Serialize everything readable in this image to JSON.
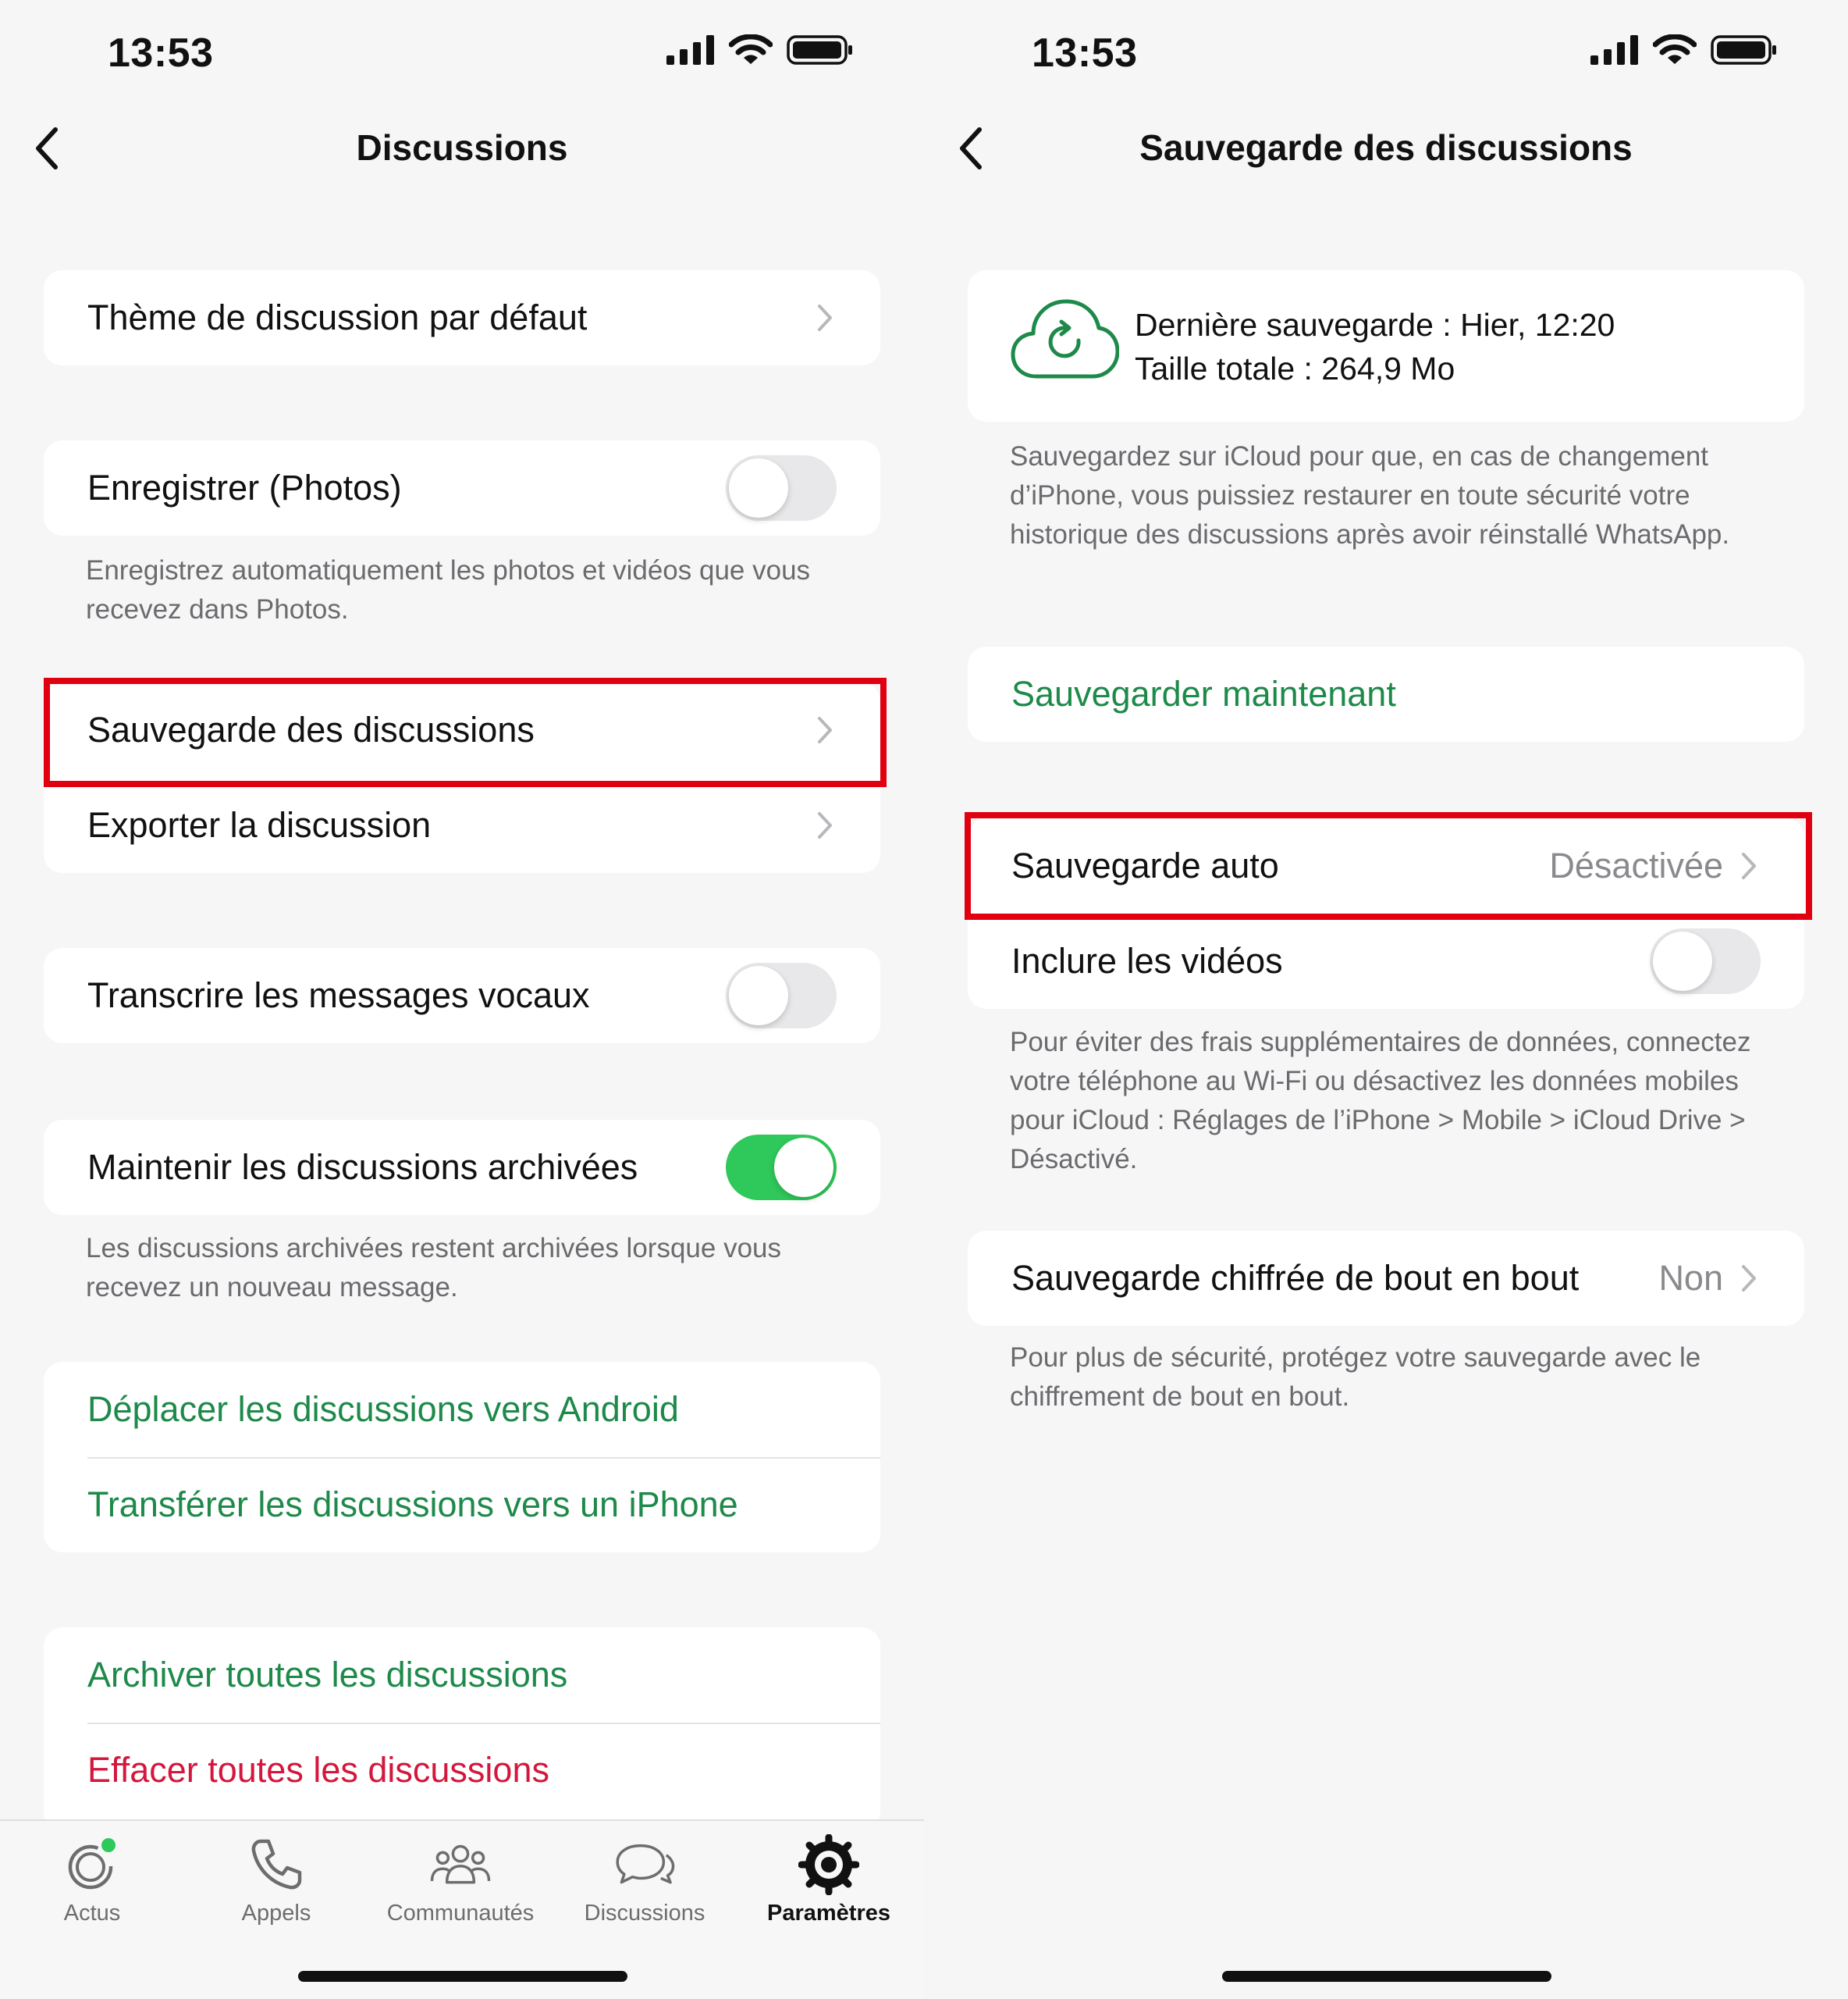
{
  "left": {
    "status_time": "13:53",
    "nav_title": "Discussions",
    "rows": {
      "theme": "Thème de discussion par défaut",
      "save_photos": "Enregistrer (Photos)",
      "save_photos_on": false,
      "save_photos_footer": "Enregistrez automatiquement les photos et vidéos que vous recevez dans Photos.",
      "chat_backup": "Sauvegarde des discussions",
      "export_chat": "Exporter la discussion",
      "transcribe": "Transcrire les messages vocaux",
      "transcribe_on": false,
      "keep_archived": "Maintenir les discussions archivées",
      "keep_archived_on": true,
      "keep_archived_footer": "Les discussions archivées restent archivées lorsque vous recevez un nouveau message.",
      "move_android": "Déplacer les discussions vers Android",
      "transfer_iphone": "Transférer les discussions vers un iPhone",
      "archive_all": "Archiver toutes les discussions",
      "clear_all": "Effacer toutes les discussions"
    },
    "tabs": [
      {
        "label": "Actus",
        "icon": "updates-icon"
      },
      {
        "label": "Appels",
        "icon": "phone-icon"
      },
      {
        "label": "Communautés",
        "icon": "communities-icon"
      },
      {
        "label": "Discussions",
        "icon": "chats-icon"
      },
      {
        "label": "Paramètres",
        "icon": "settings-icon",
        "active": true
      }
    ]
  },
  "right": {
    "status_time": "13:53",
    "nav_title": "Sauvegarde des discussions",
    "last_backup": "Dernière sauvegarde : Hier, 12:20",
    "total_size": "Taille totale : 264,9 Mo",
    "info_footer": "Sauvegardez sur iCloud pour que, en cas de changement d’iPhone, vous puissiez restaurer en toute sécurité votre historique des discussions après avoir réinstallé WhatsApp.",
    "backup_now": "Sauvegarder maintenant",
    "auto_backup": "Sauvegarde auto",
    "auto_backup_value": "Désactivée",
    "include_videos": "Inclure les vidéos",
    "include_videos_on": false,
    "videos_footer": "Pour éviter des frais supplémentaires de données, connectez votre téléphone au Wi-Fi ou désactivez les données mobiles pour iCloud : Réglages de l’iPhone > Mobile > iCloud Drive > Désactivé.",
    "e2e_backup": "Sauvegarde chiffrée de bout en bout",
    "e2e_backup_value": "Non",
    "e2e_footer": "Pour plus de sécurité, protégez votre sauvegarde avec le chiffrement de bout en bout."
  },
  "colors": {
    "accent_green": "#1e8a4a",
    "toggle_on": "#2fc85a",
    "destructive_red": "#d4173c",
    "highlight_red": "#e0000f"
  }
}
